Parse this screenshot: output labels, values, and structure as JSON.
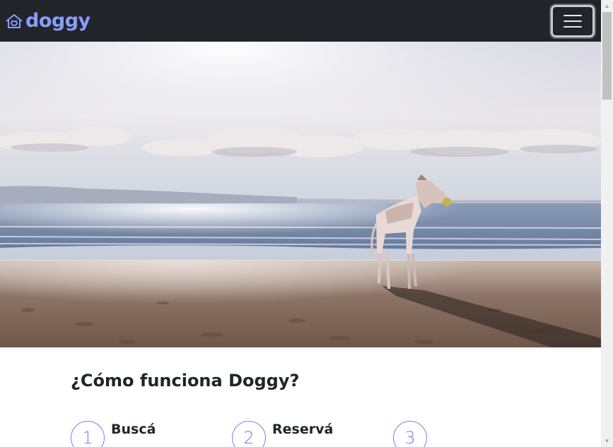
{
  "navbar": {
    "brand": "doggy",
    "brand_icon": "house-paw-icon",
    "toggler_icon": "hamburger-menu-icon",
    "brand_color": "#8a9cff",
    "background": "#212529"
  },
  "hero": {
    "image_subject": "dog-on-beach"
  },
  "how_it_works": {
    "title": "¿Cómo funciona Doggy?",
    "accent_color": "#6f82f2",
    "steps": [
      {
        "number": "1",
        "title": "Buscá"
      },
      {
        "number": "2",
        "title": "Reservá"
      },
      {
        "number": "3",
        "title": ""
      }
    ]
  }
}
